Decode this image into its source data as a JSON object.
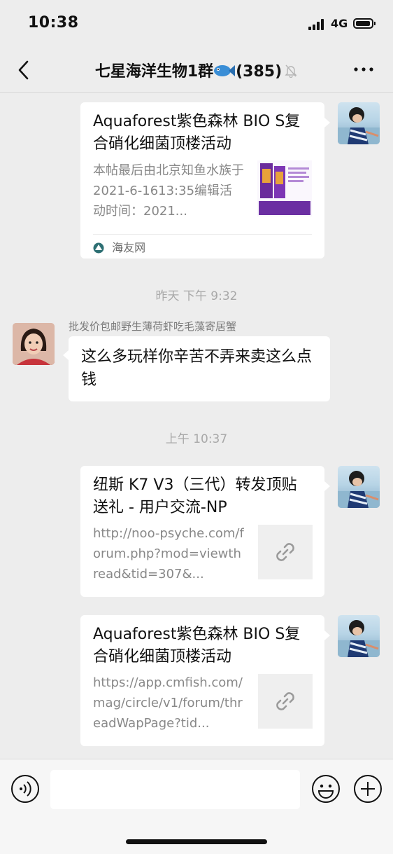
{
  "status": {
    "time": "10:38",
    "network": "4G"
  },
  "nav": {
    "title": "七星海洋生物1群",
    "count": "(385)"
  },
  "messages": [
    {
      "title": "Aquaforest紫色森林 BIO S复合硝化细菌顶楼活动",
      "description": "本帖最后由北京知鱼水族于2021-6-1613:35编辑活动时间：2021...",
      "source": "海友网"
    },
    {
      "timestamp": "昨天 下午 9:32"
    },
    {
      "sender": "批发价包邮野生薄荷虾吃毛藻寄居蟹",
      "text": "这么多玩样你辛苦不弄来卖这么点钱"
    },
    {
      "timestamp": "上午 10:37"
    },
    {
      "title": "纽斯 K7 V3（三代）转发顶贴送礼 - 用户交流-NP",
      "description": "http://noo-psyche.com/forum.php?mod=viewthread&tid=307&..."
    },
    {
      "title": "Aquaforest紫色森林 BIO S复合硝化细菌顶楼活动",
      "description": "https://app.cmfish.com/mag/circle/v1/forum/threadWapPage?tid..."
    }
  ],
  "icons": {
    "back": "back-chevron-icon",
    "fish": "fish-emoji-icon",
    "mute": "mute-bell-icon",
    "more": "more-icon",
    "voice": "voice-icon",
    "emoji": "emoji-icon",
    "add": "add-icon",
    "link": "link-icon",
    "source": "source-logo-icon"
  },
  "colors": {
    "background": "#ededed",
    "bubble": "#ffffff",
    "muted_text": "#888888"
  }
}
